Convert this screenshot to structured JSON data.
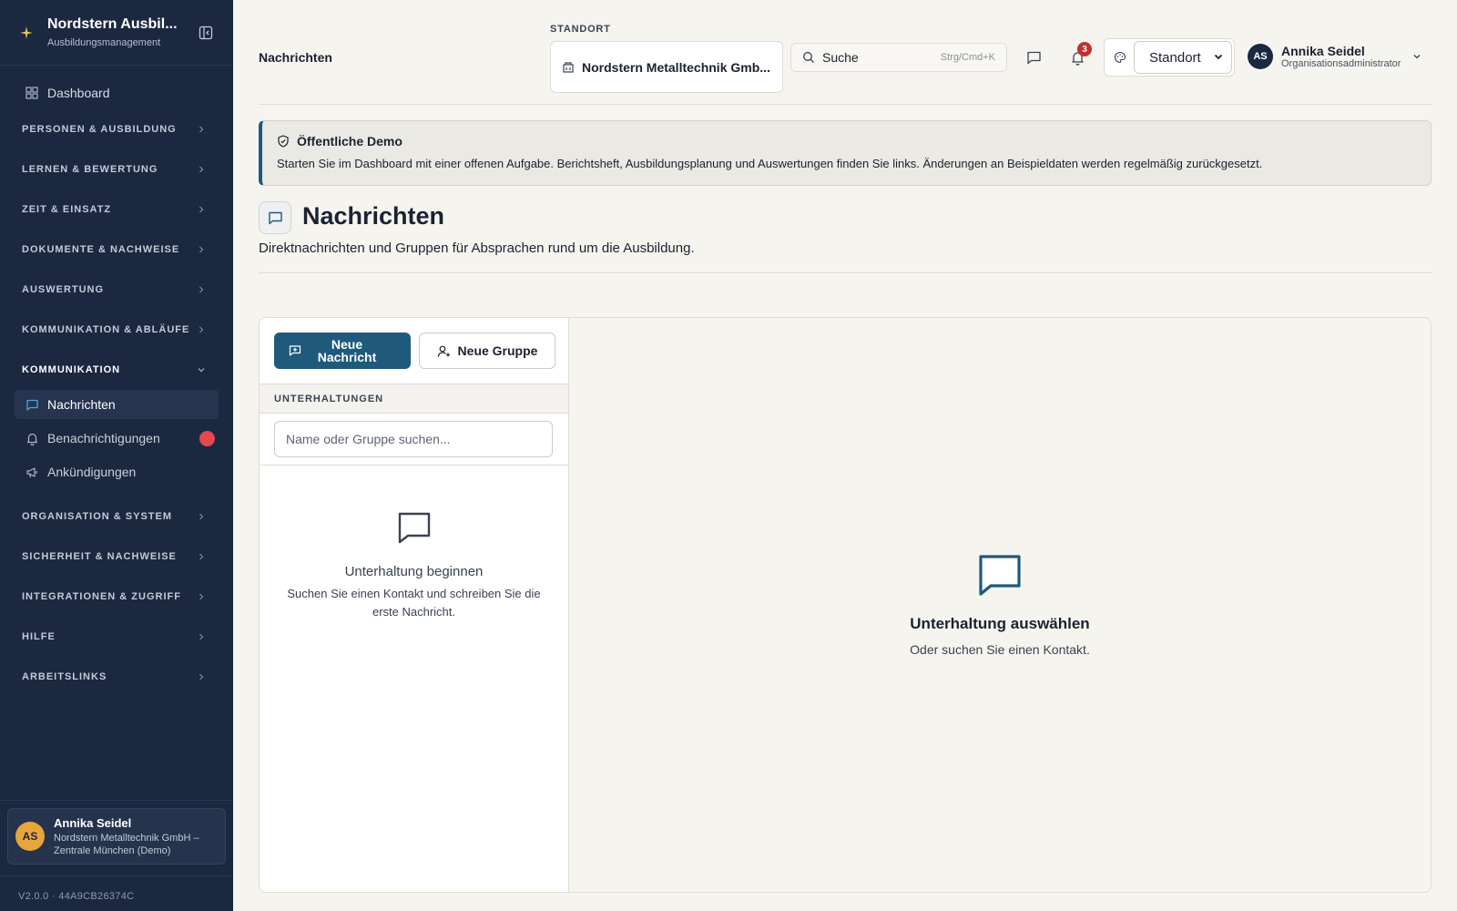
{
  "sidebar": {
    "brand_title": "Nordstern Ausbil...",
    "brand_subtitle": "Ausbildungsmanagement",
    "dashboard_label": "Dashboard",
    "groups_top": [
      {
        "label": "PERSONEN & AUSBILDUNG"
      },
      {
        "label": "LERNEN & BEWERTUNG"
      },
      {
        "label": "ZEIT & EINSATZ"
      },
      {
        "label": "DOKUMENTE & NACHWEISE"
      },
      {
        "label": "AUSWERTUNG"
      },
      {
        "label": "KOMMUNIKATION & ABLÄUFE"
      }
    ],
    "open_group": "KOMMUNIKATION",
    "sub_items": [
      {
        "label": "Nachrichten",
        "icon": "chat-icon",
        "active": true
      },
      {
        "label": "Benachrichtigungen",
        "icon": "bell-icon",
        "active": false
      },
      {
        "label": "Ankündigungen",
        "icon": "megaphone-icon",
        "active": false
      }
    ],
    "groups_bottom": [
      {
        "label": "ORGANISATION & SYSTEM"
      },
      {
        "label": "SICHERHEIT & NACHWEISE"
      },
      {
        "label": "INTEGRATIONEN & ZUGRIFF"
      },
      {
        "label": "HILFE"
      },
      {
        "label": "ARBEITSLINKS"
      }
    ],
    "user": {
      "initials": "AS",
      "name": "Annika Seidel",
      "org": "Nordstern Metalltechnik GmbH – Zentrale München (Demo)"
    },
    "version": "V2.0.0 · 44A9CB26374C"
  },
  "topbar": {
    "breadcrumb": "Nachrichten",
    "location_label": "STANDORT",
    "location_name": "Nordstern Metalltechnik Gmb...",
    "search_label": "Suche",
    "search_shortcut": "Strg/Cmd+K",
    "notification_count": "3",
    "standort_select": "Standort",
    "user_initials": "AS",
    "user_name": "Annika Seidel",
    "user_role": "Organisationsadministrator"
  },
  "banner": {
    "title": "Öffentliche Demo",
    "text": "Starten Sie im Dashboard mit einer offenen Aufgabe. Berichtsheft, Ausbildungsplanung und Auswertungen finden Sie links. Änderungen an Beispieldaten werden regelmäßig zurückgesetzt."
  },
  "page": {
    "title": "Nachrichten",
    "subtitle": "Direktnachrichten und Gruppen für Absprachen rund um die Ausbildung."
  },
  "messages": {
    "new_message": "Neue Nachricht",
    "new_group": "Neue Gruppe",
    "conversations_header": "UNTERHALTUNGEN",
    "search_placeholder": "Name oder Gruppe suchen...",
    "empty_left_title": "Unterhaltung beginnen",
    "empty_left_text": "Suchen Sie einen Kontakt und schreiben Sie die erste Nachricht.",
    "empty_right_title": "Unterhaltung auswählen",
    "empty_right_text": "Oder suchen Sie einen Kontakt."
  },
  "colors": {
    "sidebar_bg": "#1c2840",
    "primary": "#1f5a7c",
    "notification_red": "#e5484d",
    "avatar_orange": "#e7a53b"
  }
}
